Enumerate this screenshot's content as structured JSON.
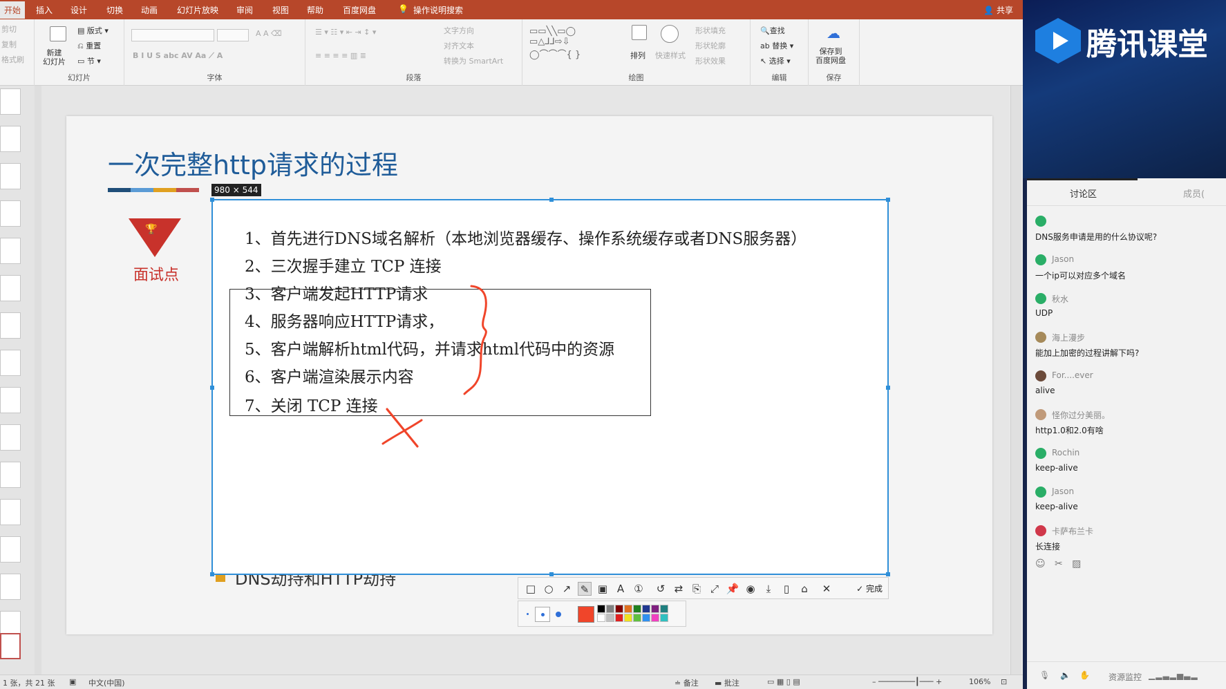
{
  "ribbon": {
    "tabs": [
      "开始",
      "插入",
      "设计",
      "切换",
      "动画",
      "幻灯片放映",
      "审阅",
      "视图",
      "帮助",
      "百度网盘",
      "操作说明搜索"
    ],
    "share": "共享",
    "clipboard": [
      "剪切",
      "复制",
      "格式刷"
    ],
    "new_slide": "新建\n幻灯片",
    "layout": "版式",
    "reset": "重置",
    "section": "节",
    "group_slides": "幻灯片",
    "group_font": "字体",
    "group_paragraph": "段落",
    "group_drawing": "绘图",
    "group_editing": "编辑",
    "group_save": "保存",
    "text_direction": "文字方向",
    "align_text": "对齐文本",
    "smartart": "转换为 SmartArt",
    "arrange": "排列",
    "quick_styles": "快速样式",
    "shape_fill": "形状填充",
    "shape_outline": "形状轮廓",
    "shape_effects": "形状效果",
    "find": "查找",
    "replace": "替换",
    "select": "选择",
    "save_baidu": "保存到\n百度网盘"
  },
  "slide": {
    "title": "一次完整http请求的过程",
    "title_bar_colors": [
      "#1f4e79",
      "#5b9bd5",
      "#e0a020",
      "#c0504d"
    ],
    "badge_label": "面试点",
    "bottom_bullet": "DNS劫持和HTTP劫持"
  },
  "capture": {
    "size_label": "980 × 544",
    "lines": [
      "1、首先进行DNS域名解析（本地浏览器缓存、操作系统缓存或者DNS服务器）",
      "2、三次握手建立 TCP 连接",
      "3、客户端发起HTTP请求",
      "4、服务器响应HTTP请求，",
      "5、客户端解析html代码，并请求html代码中的资源",
      "6、客户端渲染展示内容",
      "7、关闭 TCP 连接"
    ],
    "done_label": "完成",
    "pen_color": "#f0452a"
  },
  "statusbar": {
    "slide_info": "1 张，共 21 张",
    "language": "中文(中国)",
    "notes": "备注",
    "comments": "批注",
    "zoom": "106%"
  },
  "tencent": {
    "brand": "腾讯课堂",
    "tab_discussion": "讨论区",
    "tab_members": "成员(",
    "messages": [
      {
        "user": "",
        "text": "DNS服务申请是用的什么协议呢?",
        "avatar": "#2aae67"
      },
      {
        "user": "Jason",
        "text": "一个ip可以对应多个域名",
        "avatar": "#2aae67"
      },
      {
        "user": "秋水",
        "text": "UDP",
        "avatar": "#2aae67"
      },
      {
        "user": "海上漫步",
        "text": "能加上加密的过程讲解下吗?",
        "avatar": "#a68a5a"
      },
      {
        "user": "For....ever",
        "text": "alive",
        "avatar": "#6b4a3a"
      },
      {
        "user": "怪你过分美丽。",
        "text": "http1.0和2.0有啥",
        "avatar": "#c09a7a"
      },
      {
        "user": "Rochin",
        "text": "keep-alive",
        "avatar": "#2aae67"
      },
      {
        "user": "Jason",
        "text": "keep-alive",
        "avatar": "#2aae67"
      },
      {
        "user": "卡萨布兰卡",
        "text": "长连接",
        "avatar": "#d0384a"
      }
    ],
    "resource_monitor": "资源监控"
  }
}
